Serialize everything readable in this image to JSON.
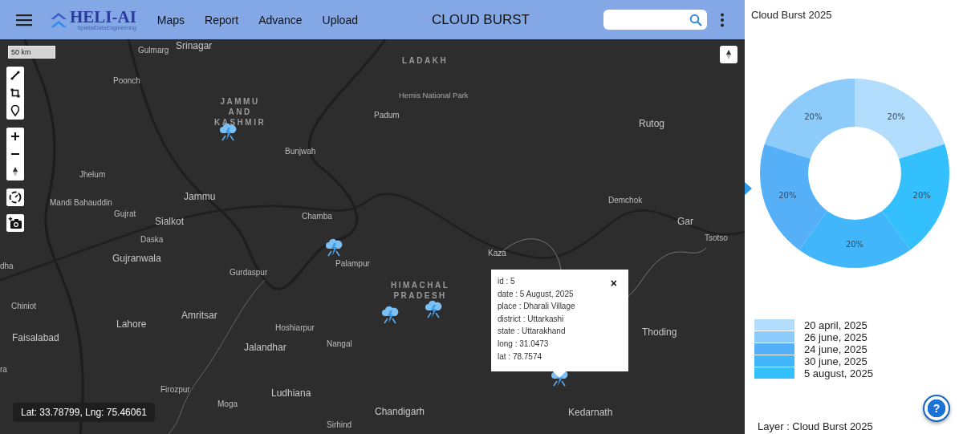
{
  "header": {
    "logo": {
      "name": "HELI-AI",
      "tagline": "SpatialDataEngineering"
    },
    "nav": [
      "Maps",
      "Report",
      "Advance",
      "Upload"
    ],
    "title": "CLOUD BURST"
  },
  "map": {
    "scale": "50 km",
    "coordinates": "Lat: 33.78799, Lng: 75.46061",
    "labels": [
      {
        "text": "Gulmarg",
        "kind": "town"
      },
      {
        "text": "Srinagar",
        "kind": "city"
      },
      {
        "text": "Poonch",
        "kind": "town"
      },
      {
        "text": "JAMMU AND KASHMIR",
        "kind": "region"
      },
      {
        "text": "Bunjwah",
        "kind": "town"
      },
      {
        "text": "Jhelum",
        "kind": "town"
      },
      {
        "text": "Mandi Bahauddin",
        "kind": "town"
      },
      {
        "text": "Jammu",
        "kind": "city"
      },
      {
        "text": "Gujrat",
        "kind": "town"
      },
      {
        "text": "Sialkot",
        "kind": "city"
      },
      {
        "text": "Chamba",
        "kind": "town"
      },
      {
        "text": "Daska",
        "kind": "town"
      },
      {
        "text": "Gujranwala",
        "kind": "city"
      },
      {
        "text": "Palampur",
        "kind": "town"
      },
      {
        "text": "Gurdaspur",
        "kind": "town"
      },
      {
        "text": "dha",
        "kind": "town"
      },
      {
        "text": "Chiniot",
        "kind": "town"
      },
      {
        "text": "Amritsar",
        "kind": "city"
      },
      {
        "text": "Lahore",
        "kind": "city"
      },
      {
        "text": "Hoshiarpur",
        "kind": "town"
      },
      {
        "text": "Faisalabad",
        "kind": "city"
      },
      {
        "text": "Jalandhar",
        "kind": "city"
      },
      {
        "text": "Nangal",
        "kind": "town"
      },
      {
        "text": "ra",
        "kind": "town"
      },
      {
        "text": "Firozpur",
        "kind": "town"
      },
      {
        "text": "Ludhiana",
        "kind": "city"
      },
      {
        "text": "Moga",
        "kind": "town"
      },
      {
        "text": "Chandigarh",
        "kind": "city"
      },
      {
        "text": "Sirhind",
        "kind": "town"
      },
      {
        "text": "LADAKH",
        "kind": "region"
      },
      {
        "text": "Hemis National Park",
        "kind": "park"
      },
      {
        "text": "Padum",
        "kind": "town"
      },
      {
        "text": "Rutog",
        "kind": "city"
      },
      {
        "text": "Demchok",
        "kind": "town"
      },
      {
        "text": "Gar",
        "kind": "city"
      },
      {
        "text": "Tsotso",
        "kind": "town"
      },
      {
        "text": "Kaza",
        "kind": "town"
      },
      {
        "text": "HIMACHAL PRADESH",
        "kind": "region"
      },
      {
        "text": "Thoding",
        "kind": "city"
      },
      {
        "text": "Kedarnath",
        "kind": "city"
      }
    ],
    "markers": [
      {
        "kind": "cloudburst"
      },
      {
        "kind": "cloudburst"
      },
      {
        "kind": "cloudburst"
      },
      {
        "kind": "cloudburst"
      },
      {
        "kind": "cloudburst"
      }
    ],
    "popup": {
      "close": "×",
      "rows": [
        "id : 5",
        "date : 5 August, 2025",
        "place : Dharali Village",
        "district : Uttarkashi",
        "state : Uttarakhand",
        "long : 31.0473",
        "lat : 78.7574"
      ]
    }
  },
  "panel": {
    "chart_data": {
      "type": "donut",
      "categories": [
        "20 april, 2025",
        "26 june, 2025",
        "24 june, 2025",
        "30 june, 2025",
        "5 august, 2025"
      ],
      "series": [
        {
          "name": "Cloud Burst 2025",
          "values": [
            20,
            20,
            20,
            20,
            20
          ]
        }
      ],
      "value_labels": [
        "20%",
        "20%",
        "20%",
        "20%",
        "20%"
      ]
    },
    "legend": [
      {
        "color": "#b3ddfc"
      },
      {
        "color": "#8dcbfa"
      },
      {
        "color": "#56b0f8"
      },
      {
        "color": "#42b6fb"
      },
      {
        "color": "#34bffd"
      }
    ],
    "help": "?",
    "layer": "Layer : Cloud Burst 2025"
  }
}
